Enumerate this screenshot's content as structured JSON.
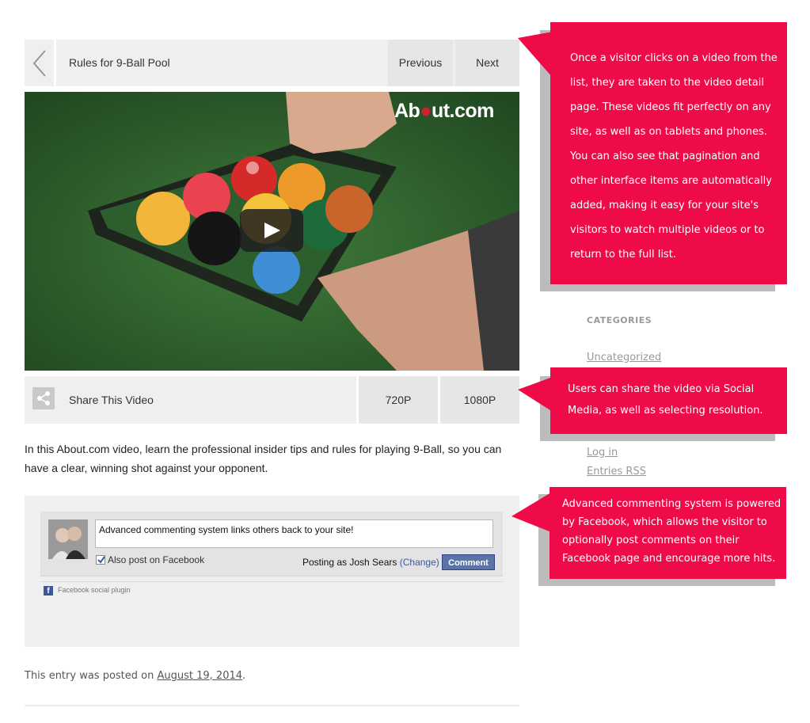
{
  "nav": {
    "title": "Rules for 9-Ball Pool",
    "prev_label": "Previous",
    "next_label": "Next"
  },
  "video": {
    "logo_text_a": "Ab",
    "logo_text_b": "ut.com"
  },
  "share": {
    "label": "Share This Video",
    "res_720": "720P",
    "res_1080": "1080P"
  },
  "description": "In this About.com video, learn the professional insider tips and rules for playing 9-Ball, so you can have a clear, winning shot against your opponent.",
  "comments": {
    "input_value": "Advanced commenting system links others back to your site!",
    "also_post_label": "Also post on Facebook",
    "also_post_checked": true,
    "posting_as_prefix": "Posting as Josh Sears",
    "change_label": "(Change)",
    "comment_button": "Comment",
    "plugin_label": "Facebook social plugin"
  },
  "entry": {
    "prefix": "This entry was posted on",
    "date": "August 19, 2014",
    "suffix": "."
  },
  "sidebar": {
    "categories_heading": "CATEGORIES",
    "category_link": "Uncategorized",
    "login_link": "Log in",
    "rss_link": "Entries RSS"
  },
  "callouts": {
    "one_lines": [
      "Once a visitor clicks on a video from the",
      "list, they are taken to the video detail",
      "page. These videos fit perfectly on any",
      "site, as well as on tablets and phones.",
      "You can also see that pagination and",
      "other interface items are automatically",
      "added, making it easy for your site's",
      "visitors to watch multiple videos or to",
      "return to the full list."
    ],
    "two_lines": [
      "Users can share the video via Social",
      "Media, as well as selecting resolution."
    ],
    "three_lines": [
      "Advanced commenting system is powered",
      "by Facebook, which allows the visitor to",
      "optionally post comments on their",
      "Facebook page and encourage more hits."
    ]
  },
  "colors": {
    "callout": "#ef0a48",
    "panel": "#efefef",
    "facebook": "#3b5998"
  },
  "icons": [
    "chevron-left-icon",
    "play-icon",
    "share-icon",
    "checkbox-icon",
    "facebook-icon"
  ]
}
